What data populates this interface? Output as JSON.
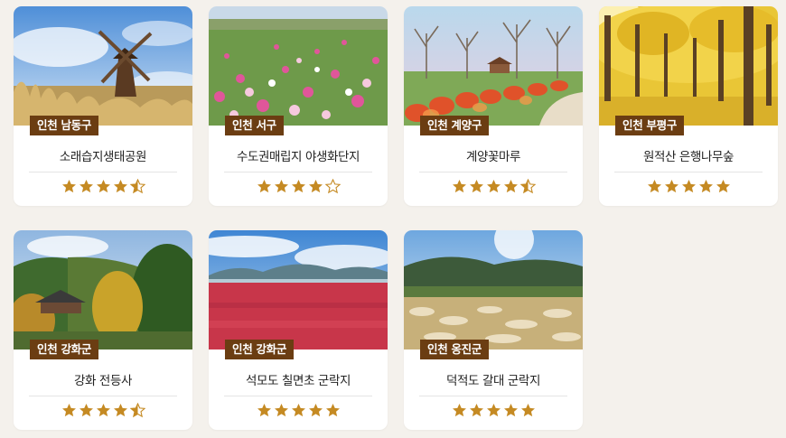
{
  "colors": {
    "accent_badge": "#6b3d12",
    "star_fill": "#c58a23",
    "star_empty_stroke": "#c58a23"
  },
  "cards": [
    {
      "district": "인천 남동구",
      "title": "소래습지생태공원",
      "rating": 4.5,
      "image": "windmill"
    },
    {
      "district": "인천 서구",
      "title": "수도권매립지 야생화단지",
      "rating": 4,
      "image": "cosmos-field"
    },
    {
      "district": "인천 계양구",
      "title": "계양꽃마루",
      "rating": 4.5,
      "image": "red-bushes-park"
    },
    {
      "district": "인천 부평구",
      "title": "원적산 은행나무숲",
      "rating": 5,
      "image": "ginkgo-forest"
    },
    {
      "district": "인천 강화군",
      "title": "강화 전등사",
      "rating": 4.5,
      "image": "temple-autumn"
    },
    {
      "district": "인천 강화군",
      "title": "석모도 칠면초 군락지",
      "rating": 5,
      "image": "red-salt-marsh"
    },
    {
      "district": "인천 옹진군",
      "title": "덕적도 갈대 군락지",
      "rating": 5,
      "image": "reed-field"
    }
  ]
}
